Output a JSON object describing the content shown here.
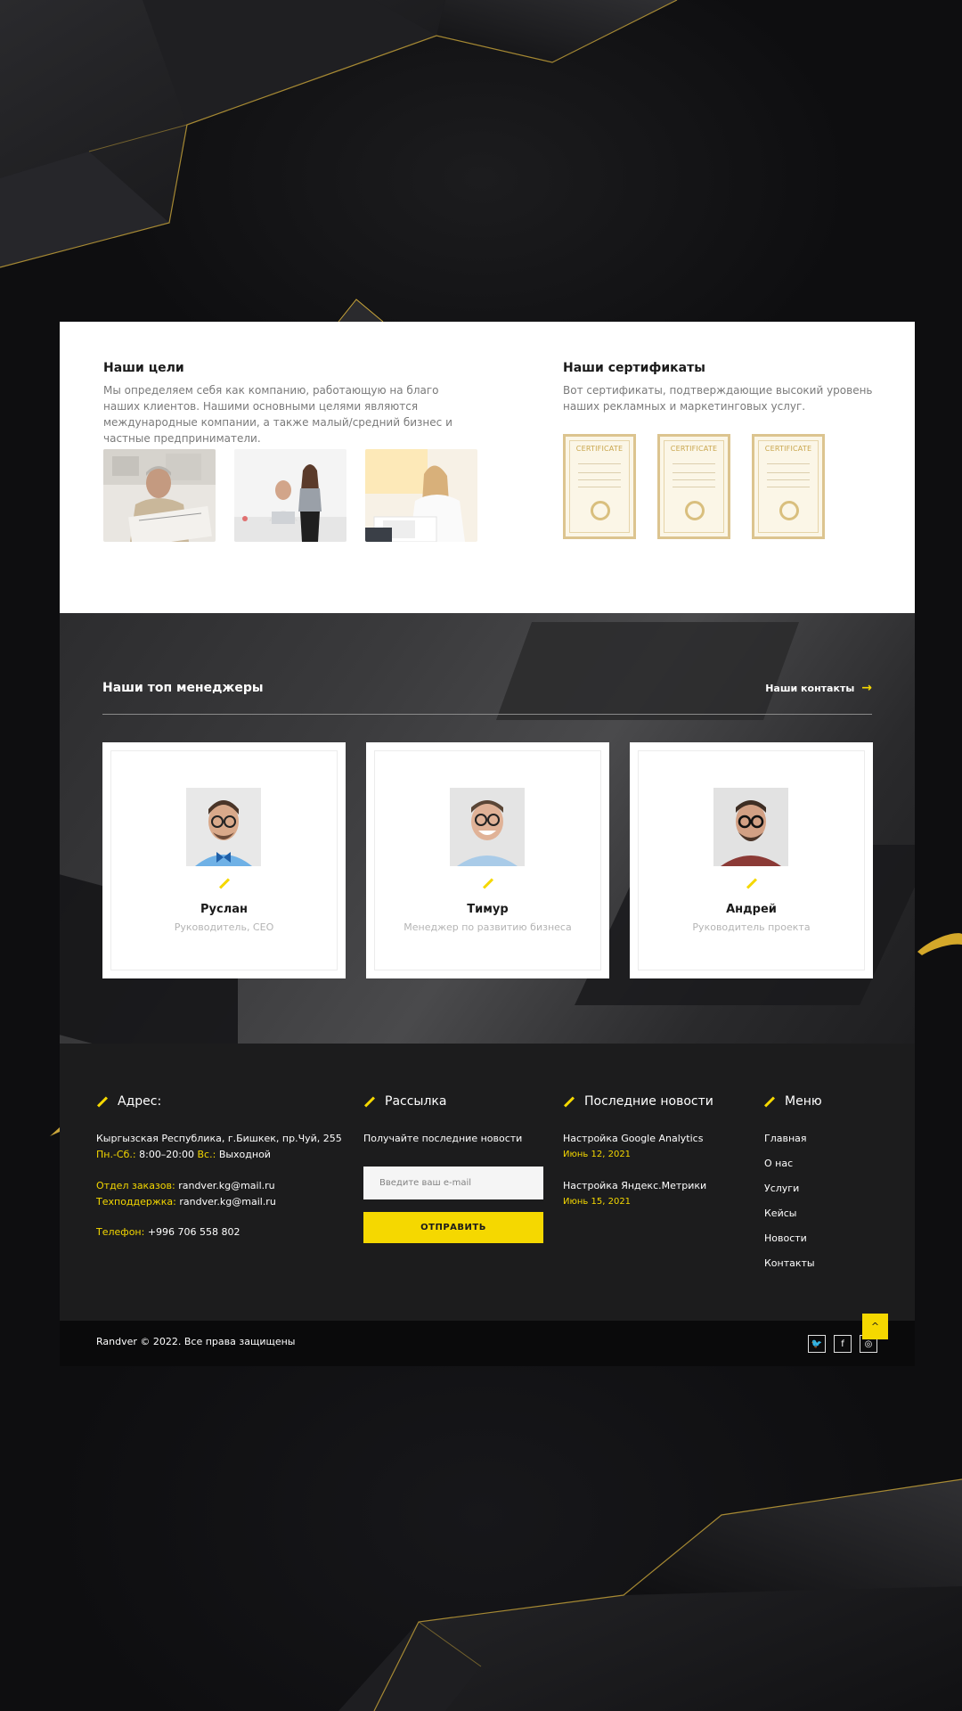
{
  "goals": {
    "title": "Наши цели",
    "text": "Мы определяем себя как компанию, работающую на благо наших клиентов. Нашими основными целями являются международные компании, а также малый/средний бизнес и частные предприниматели."
  },
  "certificates": {
    "title": "Наши сертификаты",
    "text": "Вот сертификаты, подтверждающие высокий уровень наших рекламных и маркетинговых услуг.",
    "label": "CERTIFICATE"
  },
  "managers": {
    "heading": "Наши топ менеджеры",
    "contacts_link": "Наши контакты",
    "items": [
      {
        "name": "Руслан",
        "role": "Руководитель, CEO"
      },
      {
        "name": "Тимур",
        "role": "Менеджер по развитию бизнеса"
      },
      {
        "name": "Андрей",
        "role": "Руководитель проекта"
      }
    ]
  },
  "footer": {
    "address": {
      "title": "Адрес:",
      "line1": "Кыргызская Республика, г.Бишкек, пр.Чуй, 255",
      "hours_label1": "Пн.-Сб.:",
      "hours_value1": "8:00–20:00",
      "hours_label2": "Вс.:",
      "hours_value2": "Выходной",
      "orders_label": "Отдел заказов:",
      "orders_value": "randver.kg@mail.ru",
      "support_label": "Техподдержка:",
      "support_value": "randver.kg@mail.ru",
      "phone_label": "Телефон:",
      "phone_value": "+996 706 558 802"
    },
    "newsletter": {
      "title": "Рассылка",
      "text": "Получайте последние новости",
      "placeholder": "Введите ваш e-mail",
      "button": "ОТПРАВИТЬ"
    },
    "news": {
      "title": "Последние новости",
      "items": [
        {
          "title": "Настройка Google Analytics",
          "date": "Июнь 12, 2021"
        },
        {
          "title": "Настройка Яндекс.Метрики",
          "date": "Июнь 15, 2021"
        }
      ]
    },
    "menu": {
      "title": "Меню",
      "items": [
        "Главная",
        "О нас",
        "Услуги",
        "Кейсы",
        "Новости",
        "Контакты"
      ]
    },
    "copyright": "Randver © 2022. Все права защищены",
    "social": [
      {
        "icon": "twitter-icon",
        "glyph": "🐦"
      },
      {
        "icon": "facebook-icon",
        "glyph": "f"
      },
      {
        "icon": "instagram-icon",
        "glyph": "◎"
      }
    ],
    "scroll_top": "^"
  },
  "colors": {
    "accent": "#f5d800",
    "dark": "#1c1c1d"
  }
}
